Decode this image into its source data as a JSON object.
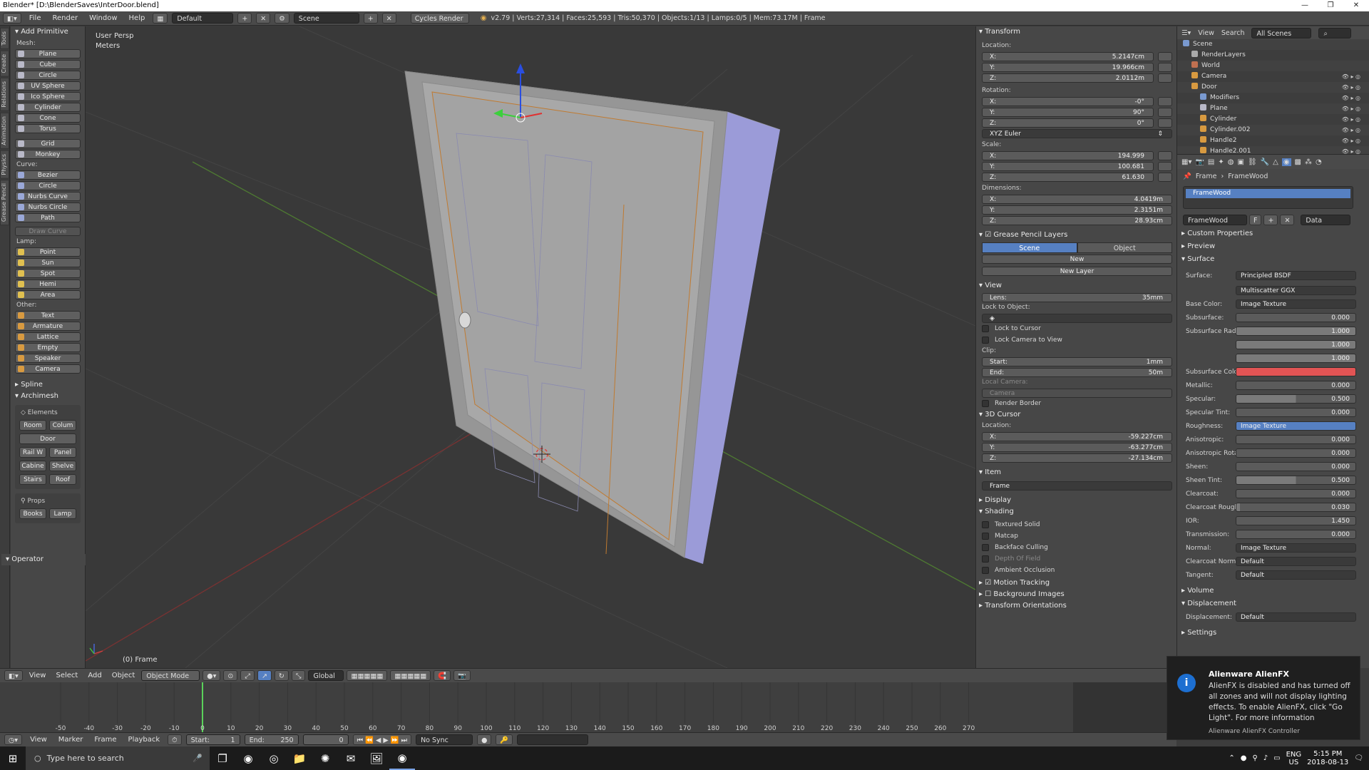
{
  "window": {
    "title": "Blender* [D:\\BlenderSaves\\InterDoor.blend]",
    "min": "—",
    "max": "❐",
    "close": "✕"
  },
  "info_header": {
    "menus": [
      "File",
      "Render",
      "Window",
      "Help"
    ],
    "layout": "Default",
    "scene": "Scene",
    "engine": "Cycles Render",
    "stats": "v2.79 | Verts:27,314 | Faces:25,593 | Tris:50,370 | Objects:1/13 | Lamps:0/5 | Mem:73.17M | Frame"
  },
  "tabs": [
    "Tools",
    "Create",
    "Relations",
    "Animation",
    "Physics",
    "Grease Pencil"
  ],
  "toolshelf": {
    "add_primitive": "Add Primitive",
    "mesh_label": "Mesh:",
    "mesh": [
      "Plane",
      "Cube",
      "Circle",
      "UV Sphere",
      "Ico Sphere",
      "Cylinder",
      "Cone",
      "Torus"
    ],
    "mesh2": [
      "Grid",
      "Monkey"
    ],
    "curve_label": "Curve:",
    "curve": [
      "Bezier",
      "Circle",
      "Nurbs Curve",
      "Nurbs Circle",
      "Path"
    ],
    "draw_curve": "Draw Curve",
    "lamp_label": "Lamp:",
    "lamp": [
      "Point",
      "Sun",
      "Spot",
      "Hemi",
      "Area"
    ],
    "other_label": "Other:",
    "other": [
      "Text",
      "Armature",
      "Lattice",
      "Empty",
      "Speaker",
      "Camera"
    ],
    "spline": "Spline",
    "archimesh": "Archimesh",
    "elements": "Elements",
    "room": "Room",
    "colum": "Colum",
    "door": "Door",
    "railw": "Rail W",
    "panel": "Panel",
    "cabine": "Cabine",
    "shelve": "Shelve",
    "stairs": "Stairs",
    "roof": "Roof",
    "props": "Props",
    "books": "Books",
    "lamp_btn": "Lamp",
    "operator": "Operator"
  },
  "viewport": {
    "view_name": "User Persp",
    "units": "Meters",
    "object_label": "(0) Frame"
  },
  "npanel": {
    "transform": "Transform",
    "location_label": "Location:",
    "location": [
      {
        "k": "X:",
        "v": "5.2147cm"
      },
      {
        "k": "Y:",
        "v": "19.966cm"
      },
      {
        "k": "Z:",
        "v": "2.0112m"
      }
    ],
    "rotation_label": "Rotation:",
    "rotation": [
      {
        "k": "X:",
        "v": "-0°"
      },
      {
        "k": "Y:",
        "v": "90°"
      },
      {
        "k": "Z:",
        "v": "0°"
      }
    ],
    "rotation_mode": "XYZ Euler",
    "scale_label": "Scale:",
    "scale": [
      {
        "k": "X:",
        "v": "194.999"
      },
      {
        "k": "Y:",
        "v": "100.681"
      },
      {
        "k": "Z:",
        "v": "61.630"
      }
    ],
    "dimensions_label": "Dimensions:",
    "dimensions": [
      {
        "k": "X:",
        "v": "4.0419m"
      },
      {
        "k": "Y:",
        "v": "2.3151m"
      },
      {
        "k": "Z:",
        "v": "28.93cm"
      }
    ],
    "grease_pencil": "Grease Pencil Layers",
    "gp_scene": "Scene",
    "gp_object": "Object",
    "gp_new": "New",
    "gp_new_layer": "New Layer",
    "view": "View",
    "lens_k": "Lens:",
    "lens_v": "35mm",
    "lock_to_object": "Lock to Object:",
    "lock_to_cursor": "Lock to Cursor",
    "lock_camera": "Lock Camera to View",
    "clip_label": "Clip:",
    "clip_start_k": "Start:",
    "clip_start_v": "1mm",
    "clip_end_k": "End:",
    "clip_end_v": "50m",
    "local_camera": "Local Camera:",
    "camera": "Camera",
    "render_border": "Render Border",
    "cursor_3d": "3D Cursor",
    "cursor_location_label": "Location:",
    "cursor": [
      {
        "k": "X:",
        "v": "-59.227cm"
      },
      {
        "k": "Y:",
        "v": "-63.277cm"
      },
      {
        "k": "Z:",
        "v": "-27.134cm"
      }
    ],
    "item": "Item",
    "item_name": "Frame",
    "display": "Display",
    "shading": "Shading",
    "shading_opts": [
      "Textured Solid",
      "Matcap",
      "Backface Culling",
      "Depth Of Field",
      "Ambient Occlusion"
    ],
    "motion_tracking": "Motion Tracking",
    "background_images": "Background Images",
    "transform_orientations": "Transform Orientations"
  },
  "outliner": {
    "view": "View",
    "search": "Search",
    "scenes": "All Scenes",
    "rows": [
      "Scene",
      "RenderLayers",
      "World",
      "Camera",
      "Door",
      "Modifiers",
      "Plane",
      "Cylinder",
      "Cylinder.002",
      "Handle2",
      "Handle2.001"
    ]
  },
  "properties": {
    "breadcrumb_obj": "Frame",
    "breadcrumb_mat": "FrameWood",
    "slot": "FrameWood",
    "material_name": "FrameWood",
    "f_label": "F",
    "data": "Data",
    "custom_properties": "Custom Properties",
    "preview": "Preview",
    "surface": "Surface",
    "surface_k": "Surface:",
    "surface_v": "Principled BSDF",
    "distribution": "Multiscatter GGX",
    "rows": [
      {
        "k": "Base Color:",
        "v": "Image Texture",
        "t": "menu"
      },
      {
        "k": "Subsurface:",
        "v": "0.000",
        "t": "num"
      },
      {
        "k": "Subsurface Radius:",
        "v": "1.000",
        "t": "num"
      },
      {
        "k": "",
        "v": "1.000",
        "t": "num"
      },
      {
        "k": "",
        "v": "1.000",
        "t": "num"
      },
      {
        "k": "Subsurface Color:",
        "v": "",
        "t": "color"
      },
      {
        "k": "Metallic:",
        "v": "0.000",
        "t": "num"
      },
      {
        "k": "Specular:",
        "v": "0.500",
        "t": "num"
      },
      {
        "k": "Specular Tint:",
        "v": "0.000",
        "t": "num"
      },
      {
        "k": "Roughness:",
        "v": "Image Texture",
        "t": "menusel"
      },
      {
        "k": "Anisotropic:",
        "v": "0.000",
        "t": "num"
      },
      {
        "k": "Anisotropic Rota...",
        "v": "0.000",
        "t": "num"
      },
      {
        "k": "Sheen:",
        "v": "0.000",
        "t": "num"
      },
      {
        "k": "Sheen Tint:",
        "v": "0.500",
        "t": "num"
      },
      {
        "k": "Clearcoat:",
        "v": "0.000",
        "t": "num"
      },
      {
        "k": "Clearcoat Rough...",
        "v": "0.030",
        "t": "num"
      },
      {
        "k": "IOR:",
        "v": "1.450",
        "t": "num"
      },
      {
        "k": "Transmission:",
        "v": "0.000",
        "t": "num"
      },
      {
        "k": "Normal:",
        "v": "Image Texture",
        "t": "menu"
      },
      {
        "k": "Clearcoat Normal:",
        "v": "Default",
        "t": "menu"
      },
      {
        "k": "Tangent:",
        "v": "Default",
        "t": "menu"
      }
    ],
    "volume": "Volume",
    "displacement": "Displacement",
    "displacement_k": "Displacement:",
    "displacement_v": "Default",
    "settings": "Settings",
    "subsurface_color": "#e25454"
  },
  "viewport_header": {
    "menus": [
      "View",
      "Select",
      "Add",
      "Object"
    ],
    "mode": "Object Mode",
    "orientation": "Global"
  },
  "timeline": {
    "ticks": [
      "-50",
      "-40",
      "-30",
      "-20",
      "-10",
      "0",
      "10",
      "20",
      "30",
      "40",
      "50",
      "60",
      "70",
      "80",
      "90",
      "100",
      "110",
      "120",
      "130",
      "140",
      "150",
      "160",
      "170",
      "180",
      "190",
      "200",
      "210",
      "220",
      "230",
      "240",
      "250",
      "260",
      "270"
    ],
    "menus": [
      "View",
      "Marker",
      "Frame",
      "Playback"
    ],
    "start_k": "Start:",
    "start_v": "1",
    "end_k": "End:",
    "end_v": "250",
    "current": "0",
    "sync": "No Sync"
  },
  "taskbar": {
    "search": "Type here to search",
    "lang1": "ENG",
    "lang2": "US",
    "time": "5:15 PM",
    "date": "2018-08-13"
  },
  "toast": {
    "icon": "i",
    "title": "Alienware AlienFX",
    "body": "AlienFX is disabled and has turned off all zones and will not display lighting effects. To enable AlienFX, click \"Go Light\". For more information",
    "footer": "Alienware AlienFX Controller"
  }
}
